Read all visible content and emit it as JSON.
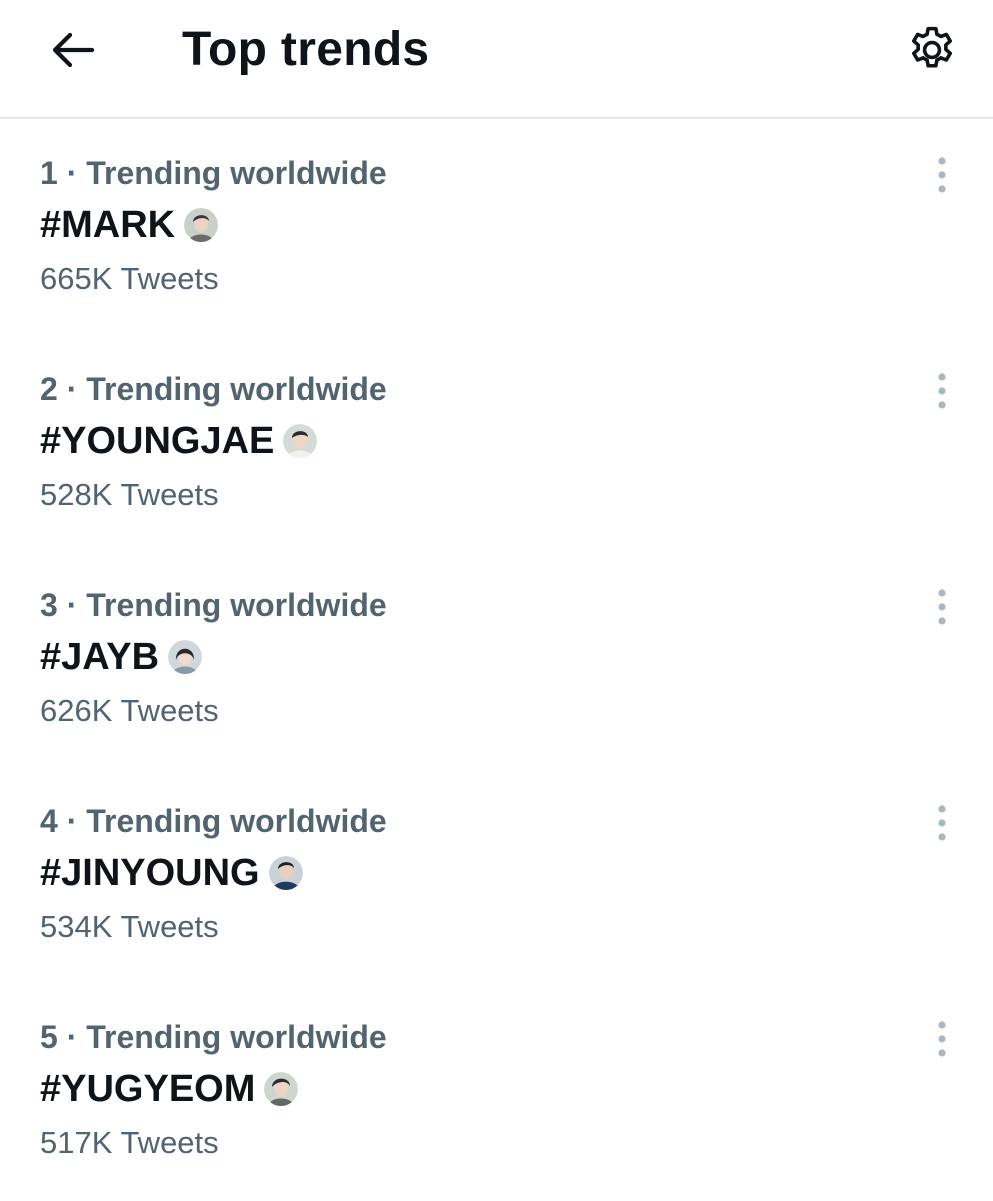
{
  "header": {
    "title": "Top trends",
    "back_icon": "arrow-left-icon",
    "settings_icon": "gear-icon"
  },
  "colors": {
    "primary_text": "#0f1419",
    "secondary_text": "#536471",
    "divider": "#e3e6e8",
    "more_icon": "#aab8c2"
  },
  "trends": [
    {
      "meta": "1 · Trending worldwide",
      "name": "#MARK",
      "count": "665K Tweets",
      "emoji": "portrait-emoji-icon"
    },
    {
      "meta": "2 · Trending worldwide",
      "name": "#YOUNGJAE",
      "count": "528K Tweets",
      "emoji": "portrait-emoji-icon"
    },
    {
      "meta": "3 · Trending worldwide",
      "name": "#JAYB",
      "count": "626K Tweets",
      "emoji": "portrait-emoji-icon"
    },
    {
      "meta": "4 · Trending worldwide",
      "name": "#JINYOUNG",
      "count": "534K Tweets",
      "emoji": "portrait-emoji-icon"
    },
    {
      "meta": "5 · Trending worldwide",
      "name": "#YUGYEOM",
      "count": "517K Tweets",
      "emoji": "portrait-emoji-icon"
    }
  ]
}
